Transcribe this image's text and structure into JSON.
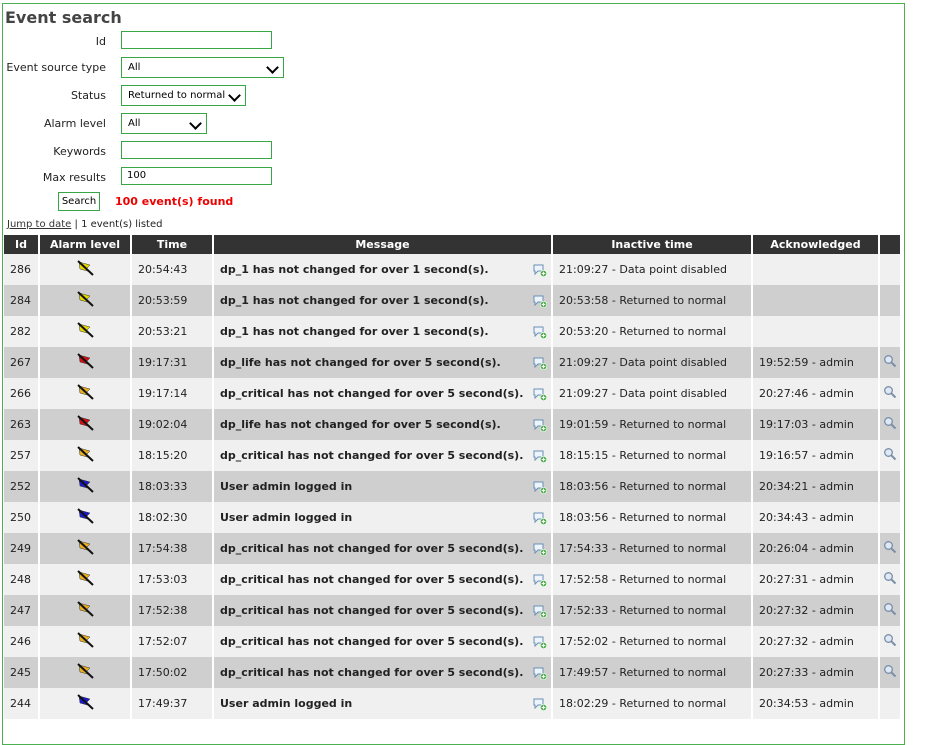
{
  "page": {
    "title": "Event search",
    "labels": {
      "id": "Id",
      "event_source_type": "Event source type",
      "status": "Status",
      "alarm_level": "Alarm level",
      "keywords": "Keywords",
      "max_results": "Max results"
    },
    "fields": {
      "id_value": "",
      "event_source_type_selected": "All",
      "status_selected": "Returned to normal",
      "alarm_level_selected": "All",
      "keywords_value": "",
      "max_results_value": "100"
    },
    "search_button": "Search",
    "found_text": "100 event(s) found",
    "jump_link": "Jump to date",
    "listed_text": "| 1 event(s) listed"
  },
  "table": {
    "headers": [
      "Id",
      "Alarm level",
      "Time",
      "Message",
      "Inactive time",
      "Acknowledged",
      ""
    ],
    "rows": [
      {
        "id": "286",
        "level": "yellow",
        "time": "20:54:43",
        "message": "dp_1 has not changed for over 1 second(s).",
        "inactive": "21:09:27 - Data point disabled",
        "ack": "",
        "ack_icon": false
      },
      {
        "id": "284",
        "level": "yellow",
        "time": "20:53:59",
        "message": "dp_1 has not changed for over 1 second(s).",
        "inactive": "20:53:58 - Returned to normal",
        "ack": "",
        "ack_icon": false
      },
      {
        "id": "282",
        "level": "yellow",
        "time": "20:53:21",
        "message": "dp_1 has not changed for over 1 second(s).",
        "inactive": "20:53:20 - Returned to normal",
        "ack": "",
        "ack_icon": false
      },
      {
        "id": "267",
        "level": "red",
        "time": "19:17:31",
        "message": "dp_life has not changed for over 5 second(s).",
        "inactive": "21:09:27 - Data point disabled",
        "ack": "19:52:59 - admin",
        "ack_icon": true
      },
      {
        "id": "266",
        "level": "orange",
        "time": "19:17:14",
        "message": "dp_critical has not changed for over 5 second(s).",
        "inactive": "21:09:27 - Data point disabled",
        "ack": "20:27:46 - admin",
        "ack_icon": true
      },
      {
        "id": "263",
        "level": "red",
        "time": "19:02:04",
        "message": "dp_life has not changed for over 5 second(s).",
        "inactive": "19:01:59 - Returned to normal",
        "ack": "19:17:03 - admin",
        "ack_icon": true
      },
      {
        "id": "257",
        "level": "orange",
        "time": "18:15:20",
        "message": "dp_critical has not changed for over 5 second(s).",
        "inactive": "18:15:15 - Returned to normal",
        "ack": "19:16:57 - admin",
        "ack_icon": true
      },
      {
        "id": "252",
        "level": "blue",
        "time": "18:03:33",
        "message": "User admin logged in",
        "inactive": "18:03:56 - Returned to normal",
        "ack": "20:34:21 - admin",
        "ack_icon": false
      },
      {
        "id": "250",
        "level": "blue",
        "time": "18:02:30",
        "message": "User admin logged in",
        "inactive": "18:03:56 - Returned to normal",
        "ack": "20:34:43 - admin",
        "ack_icon": false
      },
      {
        "id": "249",
        "level": "orange",
        "time": "17:54:38",
        "message": "dp_critical has not changed for over 5 second(s).",
        "inactive": "17:54:33 - Returned to normal",
        "ack": "20:26:04 - admin",
        "ack_icon": true
      },
      {
        "id": "248",
        "level": "orange",
        "time": "17:53:03",
        "message": "dp_critical has not changed for over 5 second(s).",
        "inactive": "17:52:58 - Returned to normal",
        "ack": "20:27:31 - admin",
        "ack_icon": true
      },
      {
        "id": "247",
        "level": "orange",
        "time": "17:52:38",
        "message": "dp_critical has not changed for over 5 second(s).",
        "inactive": "17:52:33 - Returned to normal",
        "ack": "20:27:32 - admin",
        "ack_icon": true
      },
      {
        "id": "246",
        "level": "orange",
        "time": "17:52:07",
        "message": "dp_critical has not changed for over 5 second(s).",
        "inactive": "17:52:02 - Returned to normal",
        "ack": "20:27:32 - admin",
        "ack_icon": true
      },
      {
        "id": "245",
        "level": "orange",
        "time": "17:50:02",
        "message": "dp_critical has not changed for over 5 second(s).",
        "inactive": "17:49:57 - Returned to normal",
        "ack": "20:27:33 - admin",
        "ack_icon": true
      },
      {
        "id": "244",
        "level": "blue",
        "time": "17:49:37",
        "message": "User admin logged in",
        "inactive": "18:02:29 - Returned to normal",
        "ack": "20:34:53 - admin",
        "ack_icon": false
      }
    ]
  },
  "colors": {
    "accent_border": "#39a645",
    "found_red": "#e00000",
    "header_bg": "#333333",
    "row_light": "#f0f0f0",
    "row_dark": "#cfcfcf",
    "flag_yellow": "#e8d800",
    "flag_orange": "#e8b020",
    "flag_red": "#d01010",
    "flag_blue": "#1a1acc"
  }
}
